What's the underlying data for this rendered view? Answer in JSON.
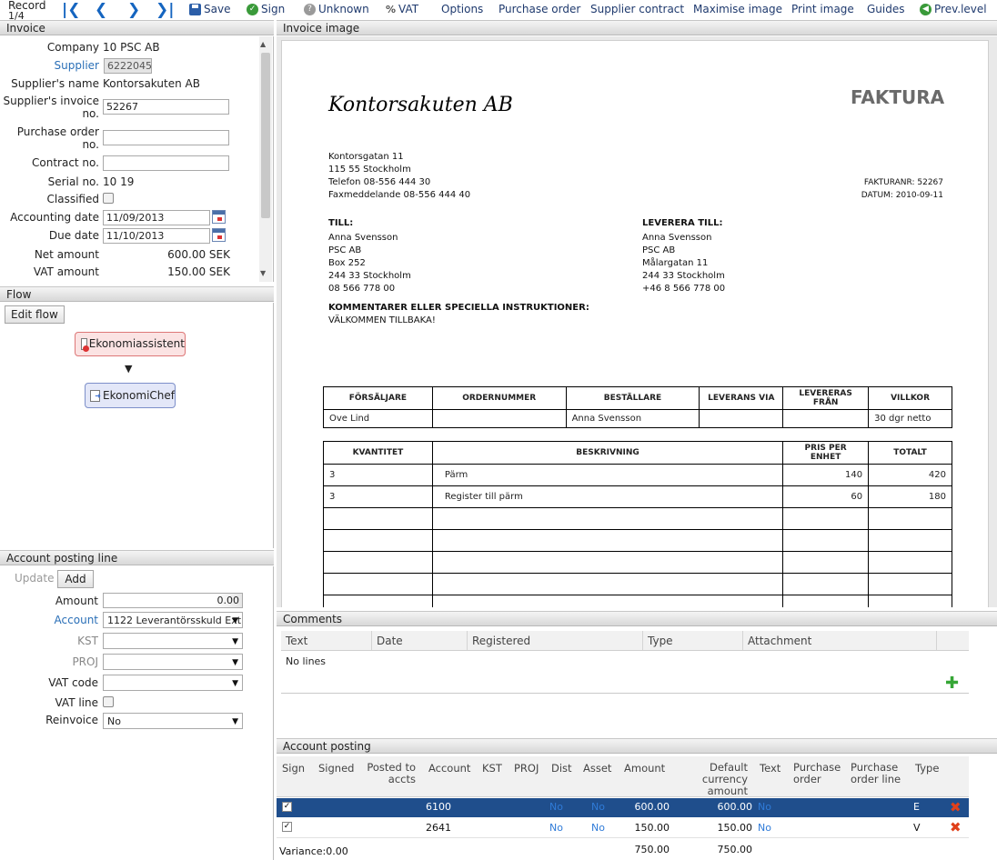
{
  "toolbar": {
    "record_label": "Record",
    "record_pos": "1/4",
    "save": "Save",
    "sign": "Sign",
    "unknown": "Unknown",
    "vat": "VAT",
    "options": "Options",
    "purchase_order": "Purchase order",
    "supplier_contract": "Supplier contract",
    "maximise_image": "Maximise image",
    "print_image": "Print image",
    "guides": "Guides",
    "prev_level": "Prev.level"
  },
  "invoice_panel": {
    "title": "Invoice",
    "company_label": "Company",
    "company_value": "10 PSC AB",
    "supplier_label": "Supplier",
    "supplier_value": "6222045",
    "supplier_name_label": "Supplier's name",
    "supplier_name_value": "Kontorsakuten AB",
    "supplier_invoice_label1": "Supplier's invoice",
    "supplier_invoice_label2": "no.",
    "supplier_invoice_value": "52267",
    "purchase_order_label1": "Purchase order",
    "purchase_order_label2": "no.",
    "purchase_order_value": "",
    "contract_label": "Contract no.",
    "contract_value": "",
    "serial_label": "Serial no.",
    "serial_value": "10 19",
    "classified_label": "Classified",
    "accounting_date_label": "Accounting date",
    "accounting_date_value": "11/09/2013",
    "due_date_label": "Due date",
    "due_date_value": "11/10/2013",
    "net_amount_label": "Net amount",
    "net_amount_value": "600.00 SEK",
    "vat_amount_label": "VAT amount",
    "vat_amount_value": "150.00 SEK"
  },
  "flow_panel": {
    "title": "Flow",
    "edit_flow": "Edit flow",
    "step1": "Ekonomiassistent",
    "step2": "EkonomiChef"
  },
  "posting_line": {
    "title": "Account posting line",
    "update": "Update",
    "add": "Add",
    "amount_label": "Amount",
    "amount_value": "0.00",
    "account_label": "Account",
    "account_value": "1122 Leverantörsskuld Ext",
    "kst_label": "KST",
    "proj_label": "PROJ",
    "vat_code_label": "VAT code",
    "vat_line_label": "VAT line",
    "reinvoice_label": "Reinvoice",
    "reinvoice_value": "No"
  },
  "image_panel": {
    "title": "Invoice image"
  },
  "invoice_doc": {
    "company": "Kontorsakuten AB",
    "heading": "FAKTURA",
    "address": [
      "Kontorsgatan 11",
      "115 55 Stockholm",
      "Telefon 08-556 444 30",
      "Faxmeddelande 08-556 444 40"
    ],
    "fakturanr": "FAKTURANR: 52267",
    "datum": "DATUM: 2010-09-11",
    "till_label": "TILL:",
    "till": [
      "Anna Svensson",
      "PSC AB",
      "Box 252",
      "244 33 Stockholm",
      "08 566 778 00"
    ],
    "leverera_label": "LEVERERA TILL:",
    "leverera": [
      "Anna Svensson",
      "PSC AB",
      "Målargatan 11",
      "244 33 Stockholm",
      "+46 8 566 778 00"
    ],
    "comment_label": "KOMMENTARER ELLER SPECIELLA INSTRUKTIONER:",
    "comment": "VÄLKOMMEN TILLBAKA!",
    "info_headers": [
      "FÖRSÄLJARE",
      "ORDERNUMMER",
      "BESTÄLLARE",
      "LEVERANS VIA",
      "LEVERERAS FRÅN",
      "VILLKOR"
    ],
    "info_values": [
      "Ove Lind",
      "",
      "Anna Svensson",
      "",
      "",
      "30 dgr netto"
    ],
    "item_headers": [
      "KVANTITET",
      "BESKRIVNING",
      "PRIS PER ENHET",
      "TOTALT"
    ],
    "items": [
      [
        "3",
        "Pärm",
        "140",
        "420"
      ],
      [
        "3",
        "Register till pärm",
        "60",
        "180"
      ],
      [
        "",
        "",
        "",
        ""
      ],
      [
        "",
        "",
        "",
        ""
      ],
      [
        "",
        "",
        "",
        ""
      ],
      [
        "",
        "",
        "",
        ""
      ],
      [
        "",
        "",
        "",
        ""
      ]
    ]
  },
  "comments_panel": {
    "title": "Comments",
    "columns": [
      "Text",
      "Date",
      "Registered",
      "Type",
      "Attachment"
    ],
    "empty": "No lines"
  },
  "account_posting": {
    "title": "Account posting",
    "columns": [
      "Sign",
      "Signed",
      "Posted to accts",
      "Account",
      "KST",
      "PROJ",
      "Dist",
      "Asset",
      "Amount",
      "Default currency amount",
      "Text",
      "Purchase order",
      "Purchase order line",
      "Type"
    ],
    "rows": [
      {
        "account": "6100",
        "dist": "No",
        "asset": "No",
        "amount": "600.00",
        "default_amount": "600.00",
        "text": "No",
        "type": "E"
      },
      {
        "account": "2641",
        "dist": "No",
        "asset": "No",
        "amount": "150.00",
        "default_amount": "150.00",
        "text": "No",
        "type": "V"
      }
    ],
    "variance": "Variance:0.00",
    "total_amount": "750.00",
    "total_default": "750.00"
  },
  "colors": {
    "selected_row": "#1f4e8c",
    "link": "#2a6fb7",
    "header_grad": "#d8d8d8"
  }
}
